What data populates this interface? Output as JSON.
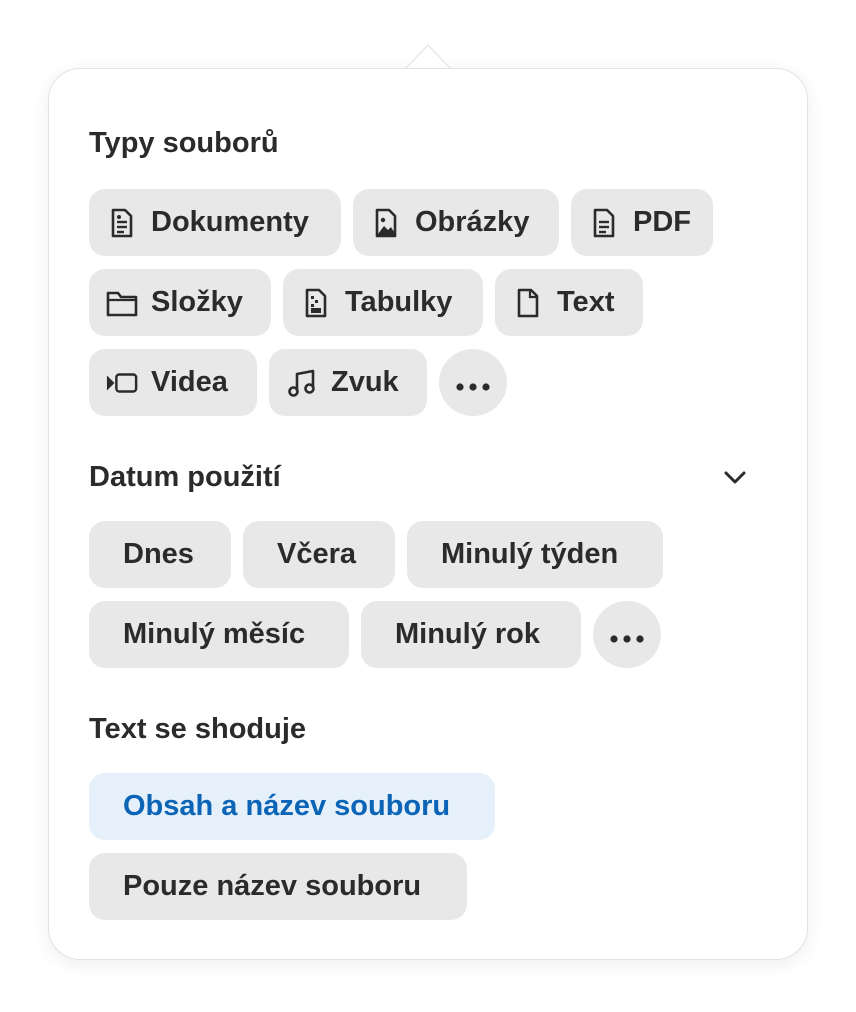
{
  "file_types": {
    "title": "Typy souborů",
    "items": [
      {
        "label": "Dokumenty",
        "icon": "document-icon"
      },
      {
        "label": "Obrázky",
        "icon": "image-icon"
      },
      {
        "label": "PDF",
        "icon": "pdf-icon"
      },
      {
        "label": "Složky",
        "icon": "folder-icon"
      },
      {
        "label": "Tabulky",
        "icon": "spreadsheet-icon"
      },
      {
        "label": "Text",
        "icon": "text-file-icon"
      },
      {
        "label": "Videa",
        "icon": "video-icon"
      },
      {
        "label": "Zvuk",
        "icon": "music-note-icon"
      }
    ],
    "more_icon": "more-horizontal-icon"
  },
  "date_used": {
    "title": "Datum použití",
    "expand_icon": "chevron-down-icon",
    "items": [
      {
        "label": "Dnes"
      },
      {
        "label": "Včera"
      },
      {
        "label": "Minulý týden"
      },
      {
        "label": "Minulý měsíc"
      },
      {
        "label": "Minulý rok"
      }
    ],
    "more_icon": "more-horizontal-icon"
  },
  "text_match": {
    "title": "Text se shoduje",
    "items": [
      {
        "label": "Obsah a název souboru",
        "selected": true
      },
      {
        "label": "Pouze název souboru",
        "selected": false
      }
    ]
  },
  "colors": {
    "chip_bg": "#e8e8e8",
    "selected_bg": "#e5f0fa",
    "selected_text": "#0b64b5",
    "text": "#2b2b2b"
  }
}
